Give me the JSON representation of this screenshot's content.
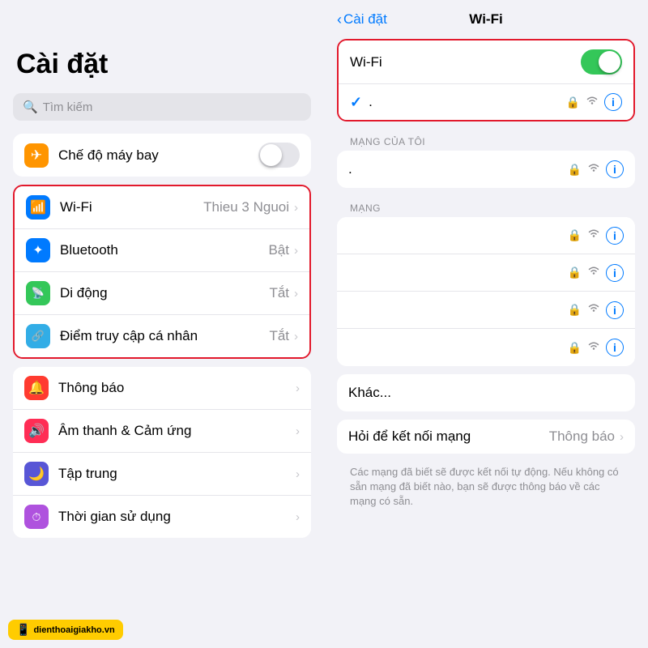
{
  "left": {
    "title": "Cài đặt",
    "search_placeholder": "Tìm kiếm",
    "group1": [
      {
        "icon_color": "orange",
        "icon": "plane",
        "label": "Chế độ máy bay",
        "value": "",
        "show_toggle": true,
        "toggle_on": false
      }
    ],
    "group2": [
      {
        "icon_color": "blue",
        "icon": "wifi",
        "label": "Wi-Fi",
        "value": "Thieu 3 Nguoi",
        "show_chevron": true,
        "highlighted": true
      },
      {
        "icon_color": "blue",
        "icon": "bluetooth",
        "label": "Bluetooth",
        "value": "Bật",
        "show_chevron": true
      },
      {
        "icon_color": "green-cell",
        "icon": "cellular",
        "label": "Di động",
        "value": "Tắt",
        "show_chevron": true
      },
      {
        "icon_color": "teal",
        "icon": "hotspot",
        "label": "Điểm truy cập cá nhân",
        "value": "Tắt",
        "show_chevron": true
      }
    ],
    "group3": [
      {
        "icon_color": "red",
        "icon": "bell",
        "label": "Thông báo",
        "show_chevron": true
      },
      {
        "icon_color": "red-dark",
        "icon": "sound",
        "label": "Âm thanh & Cảm ứng",
        "show_chevron": true
      },
      {
        "icon_color": "indigo",
        "icon": "focus",
        "label": "Tập trung",
        "show_chevron": true
      },
      {
        "icon_color": "purple",
        "icon": "screentime",
        "label": "Thời gian sử dụng",
        "show_chevron": true
      }
    ]
  },
  "right": {
    "nav_back": "Cài đặt",
    "nav_title": "Wi-Fi",
    "wifi_label": "Wi-Fi",
    "wifi_on": true,
    "connected_network_name": ".",
    "my_network_section": "MẠNG CỦA TÔI",
    "my_network_name": ".",
    "other_networks_section": "MẠNG",
    "other_networks": [
      "",
      "",
      "",
      ""
    ],
    "khac_label": "Khác...",
    "ask_join_label": "Hỏi để kết nối mạng",
    "ask_join_value": "Thông báo",
    "info_text": "Các mạng đã biết sẽ được kết nối tự động. Nếu không có sẵn mạng đã biết nào, bạn sẽ được thông báo về các mạng có sẵn."
  },
  "watermark": {
    "logo": "📱",
    "text": "dienthoaigiakho.vn"
  }
}
